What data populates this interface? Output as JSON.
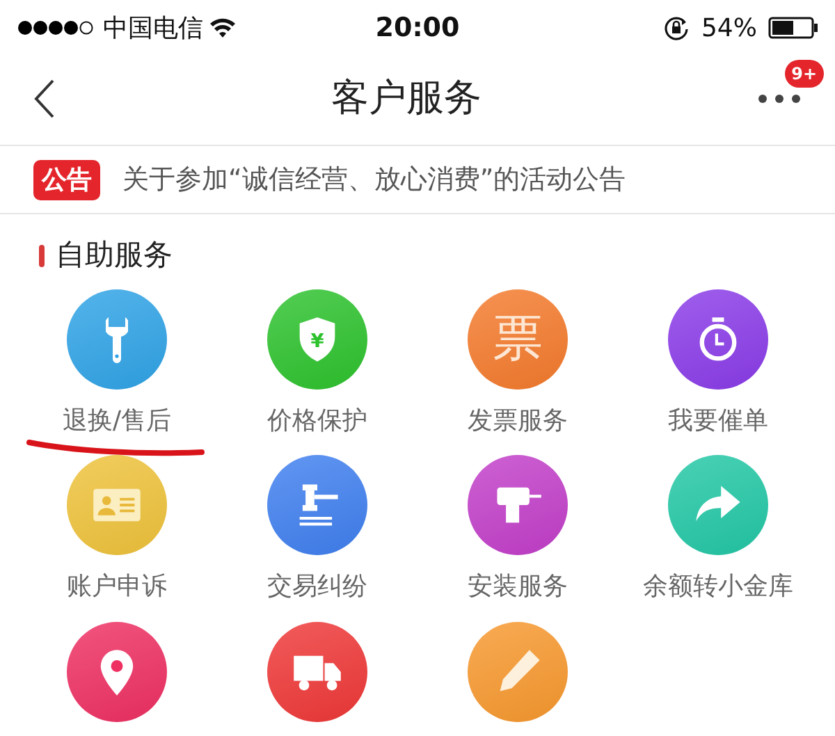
{
  "status_bar": {
    "carrier": "中国电信",
    "time": "20:00",
    "battery": "54%"
  },
  "nav": {
    "title": "客户服务",
    "badge": "9+"
  },
  "notice": {
    "tag": "公告",
    "text": "关于参加“诚信经营、放心消费”的活动公告"
  },
  "section": {
    "title": "自助服务"
  },
  "services": [
    {
      "label": "退换/售后",
      "kind": "wrench",
      "color": "#2fa3e6",
      "underlined": true
    },
    {
      "label": "价格保护",
      "kind": "shield",
      "glyph": "¥",
      "color": "#2dc22d",
      "underlined": false
    },
    {
      "label": "发票服务",
      "kind": "glyph",
      "glyph": "票",
      "color": "#f47a2c",
      "underlined": false
    },
    {
      "label": "我要催单",
      "kind": "timer",
      "color": "#8a3be8",
      "underlined": false
    },
    {
      "label": "账户申诉",
      "kind": "card",
      "color": "#eec23a",
      "underlined": false
    },
    {
      "label": "交易纠纷",
      "kind": "gavel",
      "color": "#3f7fef",
      "underlined": false
    },
    {
      "label": "安装服务",
      "kind": "drill",
      "color": "#c23ec9",
      "underlined": false
    },
    {
      "label": "余额转小金库",
      "kind": "arrow",
      "color": "#22c7a5",
      "underlined": false
    },
    {
      "kind": "pin",
      "color": "#ee2f62",
      "underlined": false
    },
    {
      "kind": "truck",
      "color": "#ef3737",
      "underlined": false
    },
    {
      "kind": "pencil",
      "color": "#f7982e",
      "underlined": false
    }
  ]
}
